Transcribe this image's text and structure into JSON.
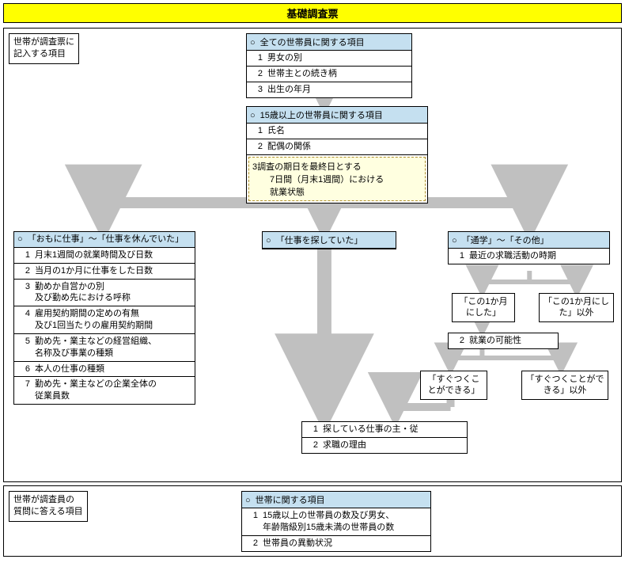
{
  "title": "基礎調査票",
  "section1": {
    "label_l1": "世帯が調査票に",
    "label_l2": "記入する項目",
    "boxA": {
      "header": "全ての世帯員に関する項目",
      "rows": [
        "男女の別",
        "世帯主との続き柄",
        "出生の年月"
      ]
    },
    "boxB": {
      "header": "15歳以上の世帯員に関する項目",
      "rows": [
        "氏名",
        "配偶の関係"
      ],
      "dashed_num": "3",
      "dashed_l1": "調査の期日を最終日とする",
      "dashed_l2": "7日間（月末1週間）における",
      "dashed_l3": "就業状態"
    },
    "boxC": {
      "header": "「おもに仕事」～「仕事を休んでいた」",
      "rows": [
        {
          "n": "1",
          "t": "月末1週間の就業時間及び日数"
        },
        {
          "n": "2",
          "t": "当月の1か月に仕事をした日数"
        },
        {
          "n": "3",
          "t": "勤めか自営かの別",
          "t2": "及び勤め先における呼称"
        },
        {
          "n": "4",
          "t": "雇用契約期間の定めの有無",
          "t2": "及び1回当たりの雇用契約期間"
        },
        {
          "n": "5",
          "t": "勤め先・業主などの経営組織、",
          "t2": "名称及び事業の種類"
        },
        {
          "n": "6",
          "t": "本人の仕事の種類"
        },
        {
          "n": "7",
          "t": "勤め先・業主などの企業全体の",
          "t2": "従業員数"
        }
      ]
    },
    "boxD": {
      "header": "「仕事を探していた」"
    },
    "boxE": {
      "header": "「通学」～「その他」",
      "row1": "最近の求職活動の時期",
      "split1a": "「この1か月にした」",
      "split1b": "「この1か月にした」以外",
      "row2": "就業の可能性",
      "split2a": "「すぐつくことができる」",
      "split2b": "「すぐつくことができる」以外"
    },
    "boxF": {
      "row1": "探している仕事の主・従",
      "row2": "求職の理由"
    }
  },
  "section2": {
    "label_l1": "世帯が調査員の",
    "label_l2": "質問に答える項目",
    "box": {
      "header": "世帯に関する項目",
      "row1a": "15歳以上の世帯員の数及び男女、",
      "row1b": "年齢階級別15歳未満の世帯員の数",
      "row2": "世帯員の異動状況"
    }
  }
}
